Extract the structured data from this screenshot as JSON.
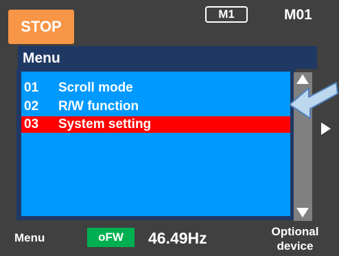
{
  "status": {
    "label": "STOP",
    "color": "#f79646"
  },
  "mode_badge": "M1",
  "mode_code": "M01",
  "menu": {
    "title": "Menu",
    "items": [
      {
        "number": "01",
        "label": "Scroll mode",
        "selected": false
      },
      {
        "number": "02",
        "label": "R/W function",
        "selected": false
      },
      {
        "number": "03",
        "label": "System setting",
        "selected": true
      }
    ],
    "panel_color": "#0099ff",
    "selection_color": "#ff0000"
  },
  "scrollbar": {
    "up_icon": "triangle-up-icon",
    "down_icon": "triangle-down-icon"
  },
  "footer": {
    "left_label": "Menu",
    "direction_badge": "oFW",
    "direction_color": "#00b050",
    "frequency": "46.49Hz",
    "right_label_line1": "Optional",
    "right_label_line2": "device"
  }
}
